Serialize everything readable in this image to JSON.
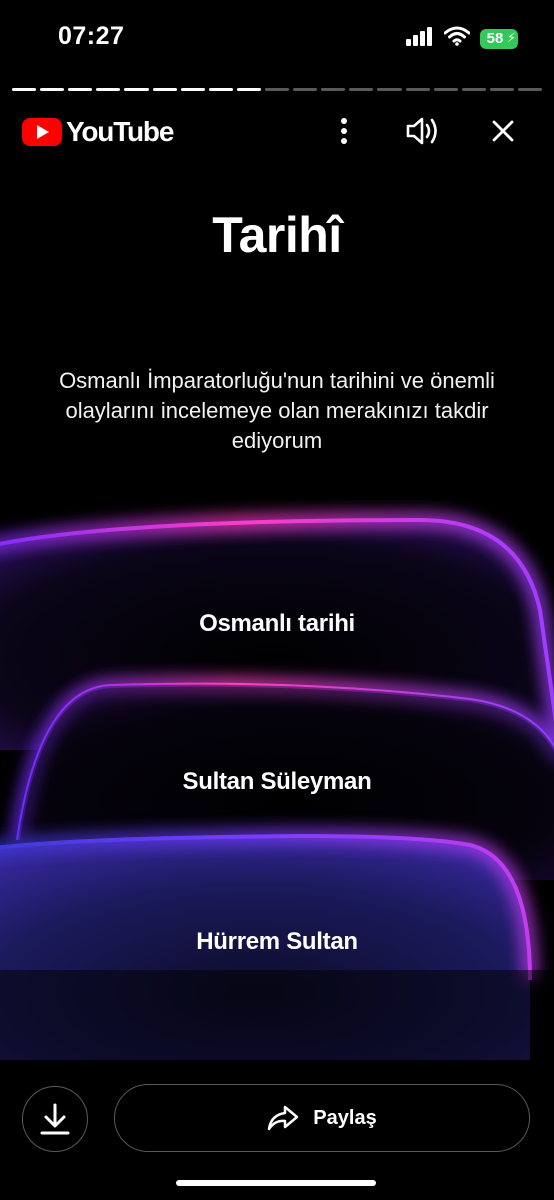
{
  "status_bar": {
    "time": "07:27",
    "battery_level": "58",
    "icons": [
      "cellular-signal-icon",
      "wifi-icon",
      "battery-charging-icon"
    ]
  },
  "story_progress": {
    "total_segments": 19,
    "completed_segments": 9
  },
  "header": {
    "logo_text": "YouTube",
    "icons": [
      "more-vert-icon",
      "volume-icon",
      "close-icon"
    ]
  },
  "content": {
    "title": "Tarihî",
    "description": "Osmanlı İmparatorluğu'nun tarihini ve önemli olaylarını incelemeye olan merakınızı takdir ediyorum",
    "options": [
      {
        "label": "Osmanlı tarihi"
      },
      {
        "label": "Sultan Süleyman"
      },
      {
        "label": "Hürrem Sultan"
      }
    ]
  },
  "bottom_bar": {
    "download_icon": "download-icon",
    "share_icon": "share-icon",
    "share_label": "Paylaş"
  },
  "colors": {
    "background": "#000000",
    "accent_pink": "#ff3cc8",
    "accent_purple": "#7a2cff",
    "accent_blue": "#3a3ad6",
    "brand_red": "#ff0000",
    "battery_green": "#34c759"
  }
}
